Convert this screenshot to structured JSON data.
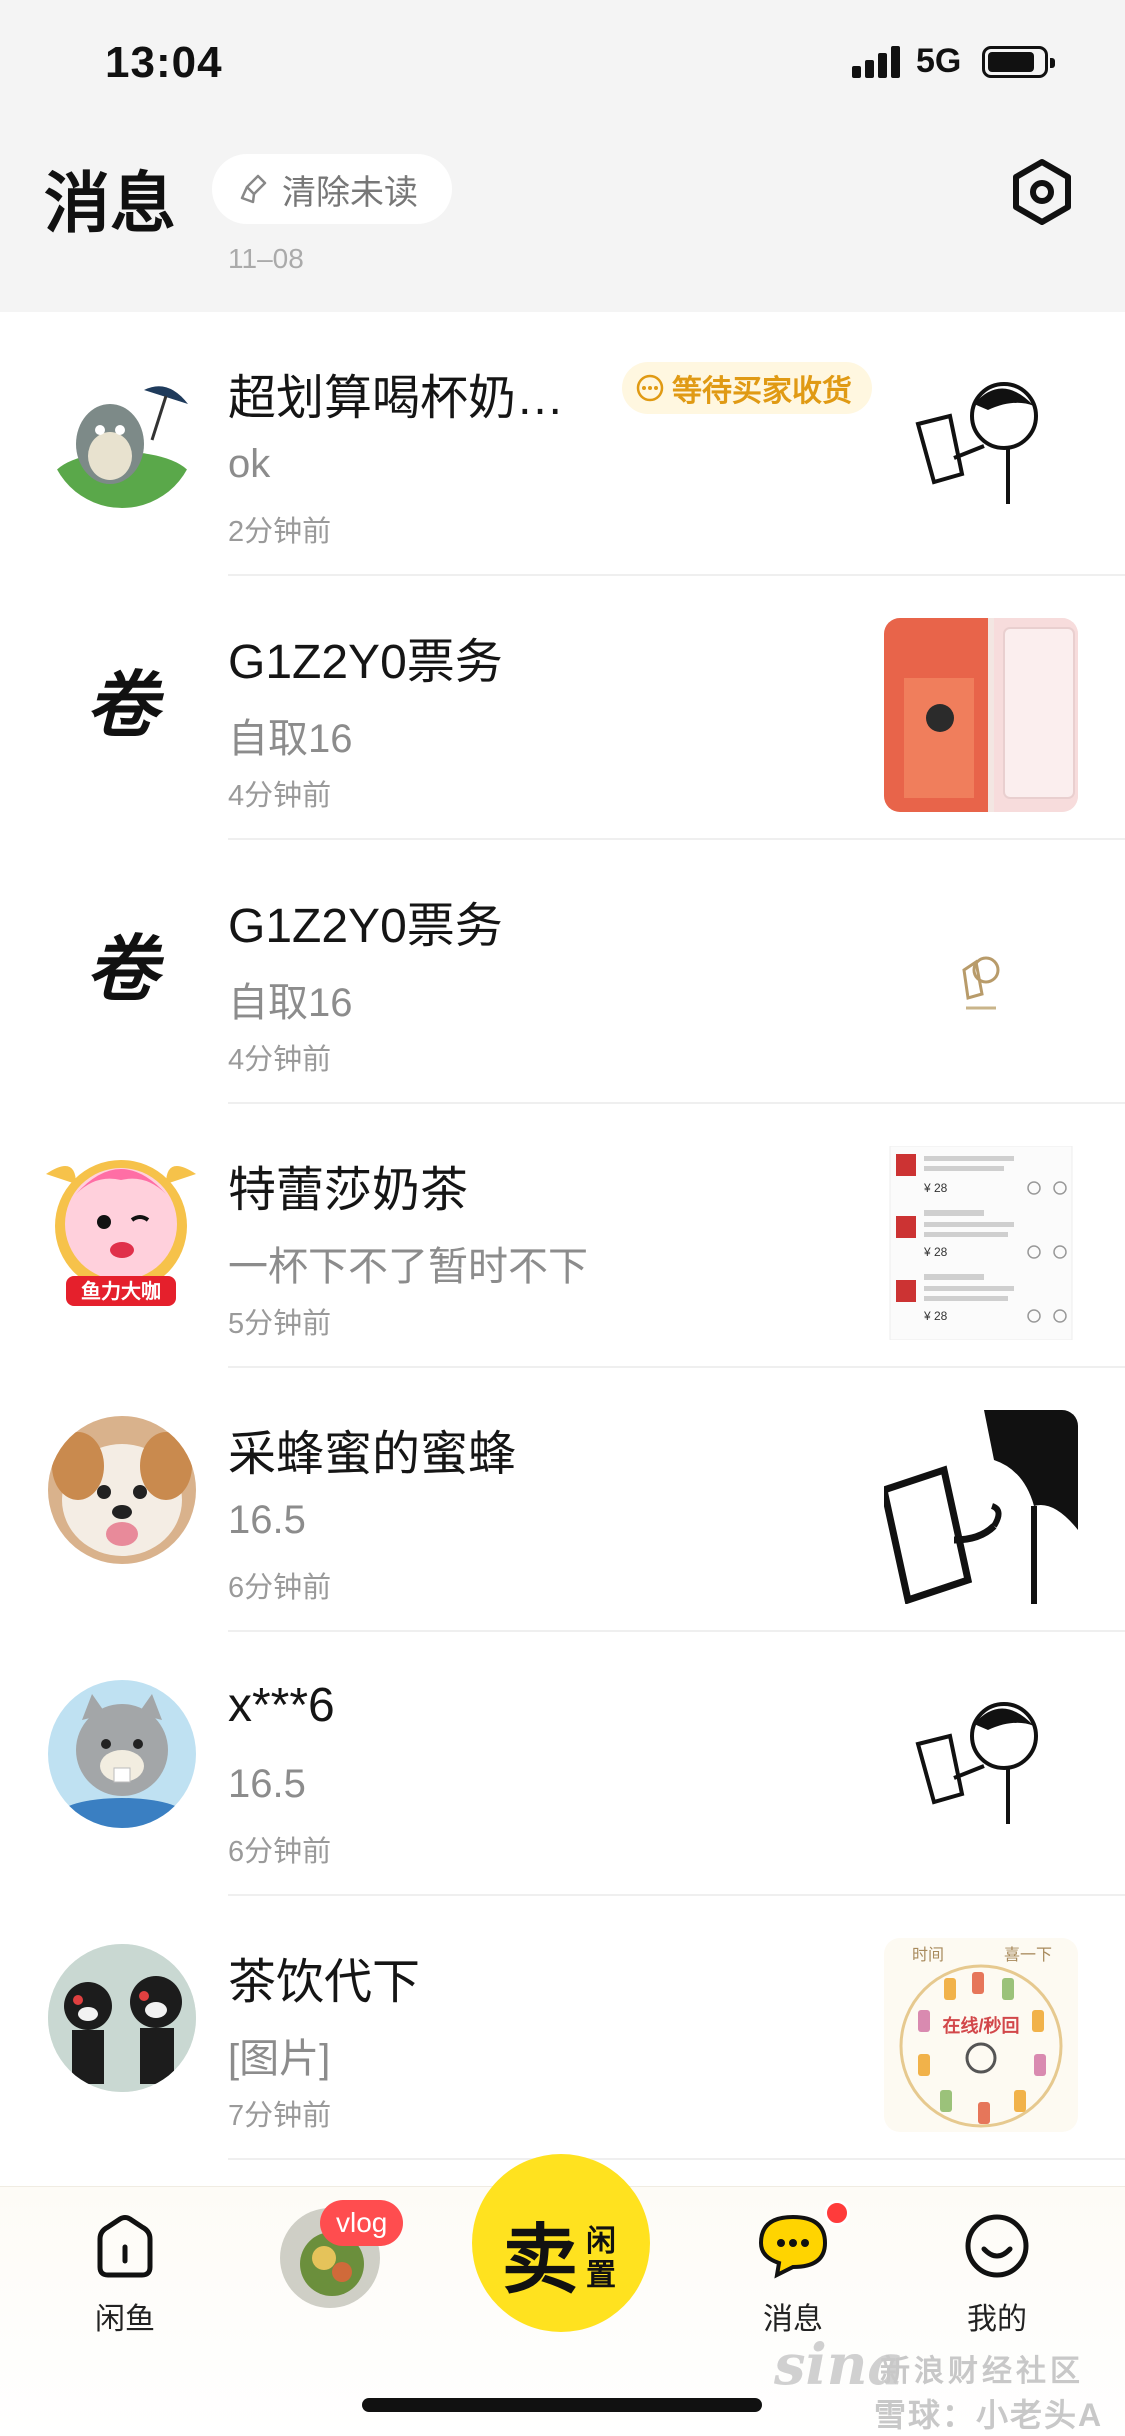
{
  "status_bar": {
    "time": "13:04",
    "network": "5G"
  },
  "header": {
    "title": "消息",
    "clear_unread_label": "清除未读",
    "partial_date": "11–08"
  },
  "messages": [
    {
      "name": "超划算喝杯奶…",
      "preview": "ok",
      "time": "2分钟前",
      "badge": "等待买家收货"
    },
    {
      "name": "G1Z2Y0票务",
      "preview": "自取16",
      "time": "4分钟前"
    },
    {
      "name": "G1Z2Y0票务",
      "preview": "自取16",
      "time": "4分钟前"
    },
    {
      "name": "特蕾莎奶茶",
      "preview": "一杯下不了暂时不下",
      "time": "5分钟前"
    },
    {
      "name": "采蜂蜜的蜜蜂",
      "preview": "16.5",
      "time": "6分钟前"
    },
    {
      "name": "x***6",
      "preview": "16.5",
      "time": "6分钟前"
    },
    {
      "name": "茶饮代下",
      "preview": "[图片]",
      "time": "7分钟前"
    }
  ],
  "avatar_texts": {
    "juan": "卷",
    "ribbon": "鱼力大咖"
  },
  "thumb_texts": {
    "price": "¥ 28",
    "menu_top_left": "时间",
    "menu_top_right": "喜一下",
    "menu_center": "在线/秒回"
  },
  "bottom_nav": {
    "home_label": "闲鱼",
    "vlog_tag": "vlog",
    "sell_big": "卖",
    "sell_small_1": "闲",
    "sell_small_2": "置",
    "messages_label": "消息",
    "me_label": "我的"
  },
  "watermark": {
    "brand": "sina",
    "line1": "新浪财经社区",
    "line2": "雪球：小老头A"
  },
  "colors": {
    "accent": "#ffe21f",
    "badge_text": "#e09a14",
    "notify": "#ff3b3b"
  }
}
